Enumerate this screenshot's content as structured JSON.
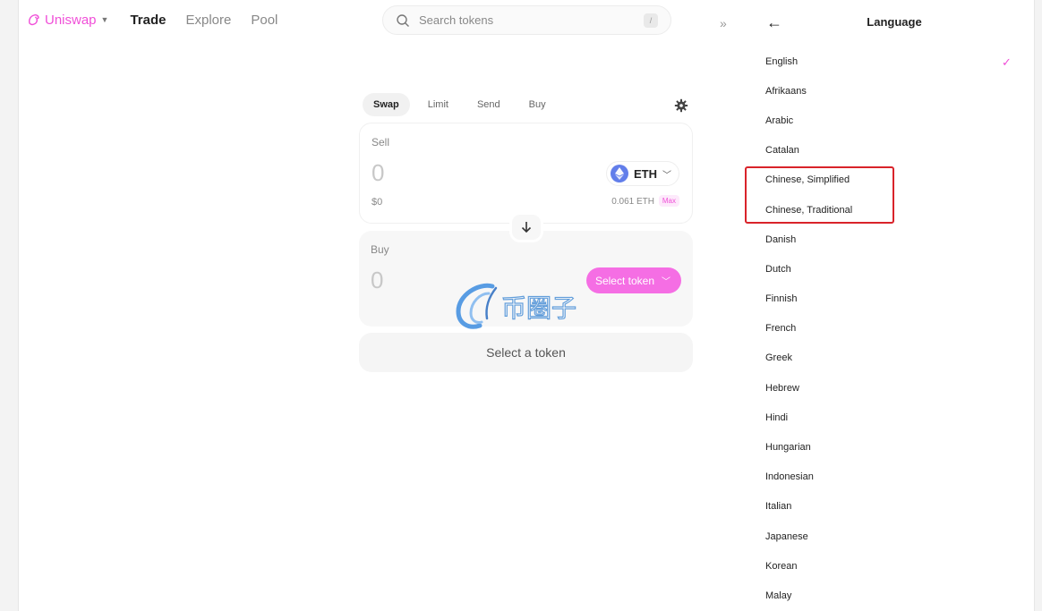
{
  "nav": {
    "brand": "Uniswap",
    "links": [
      "Trade",
      "Explore",
      "Pool"
    ],
    "search_placeholder": "Search tokens",
    "search_shortcut": "/",
    "collapse": "»"
  },
  "swap": {
    "tabs": [
      "Swap",
      "Limit",
      "Send",
      "Buy"
    ],
    "sell": {
      "label": "Sell",
      "amount": "0",
      "token": "ETH",
      "usd": "$0",
      "balance": "0.061 ETH",
      "max": "Max"
    },
    "buy": {
      "label": "Buy",
      "amount": "0",
      "select_token": "Select token"
    },
    "cta": "Select a token"
  },
  "language_panel": {
    "back": "←",
    "title": "Language",
    "selected": "English",
    "languages": [
      "English",
      "Afrikaans",
      "Arabic",
      "Catalan",
      "Chinese, Simplified",
      "Chinese, Traditional",
      "Danish",
      "Dutch",
      "Finnish",
      "French",
      "Greek",
      "Hebrew",
      "Hindi",
      "Hungarian",
      "Indonesian",
      "Italian",
      "Japanese",
      "Korean",
      "Malay"
    ],
    "highlighted": [
      "Chinese, Simplified",
      "Chinese, Traditional"
    ]
  },
  "watermark": {
    "text": "币圈子"
  },
  "colors": {
    "accent": "#f04fd8",
    "button": "#f56ee4",
    "highlight_border": "#d9232a",
    "eth": "#627eea"
  }
}
